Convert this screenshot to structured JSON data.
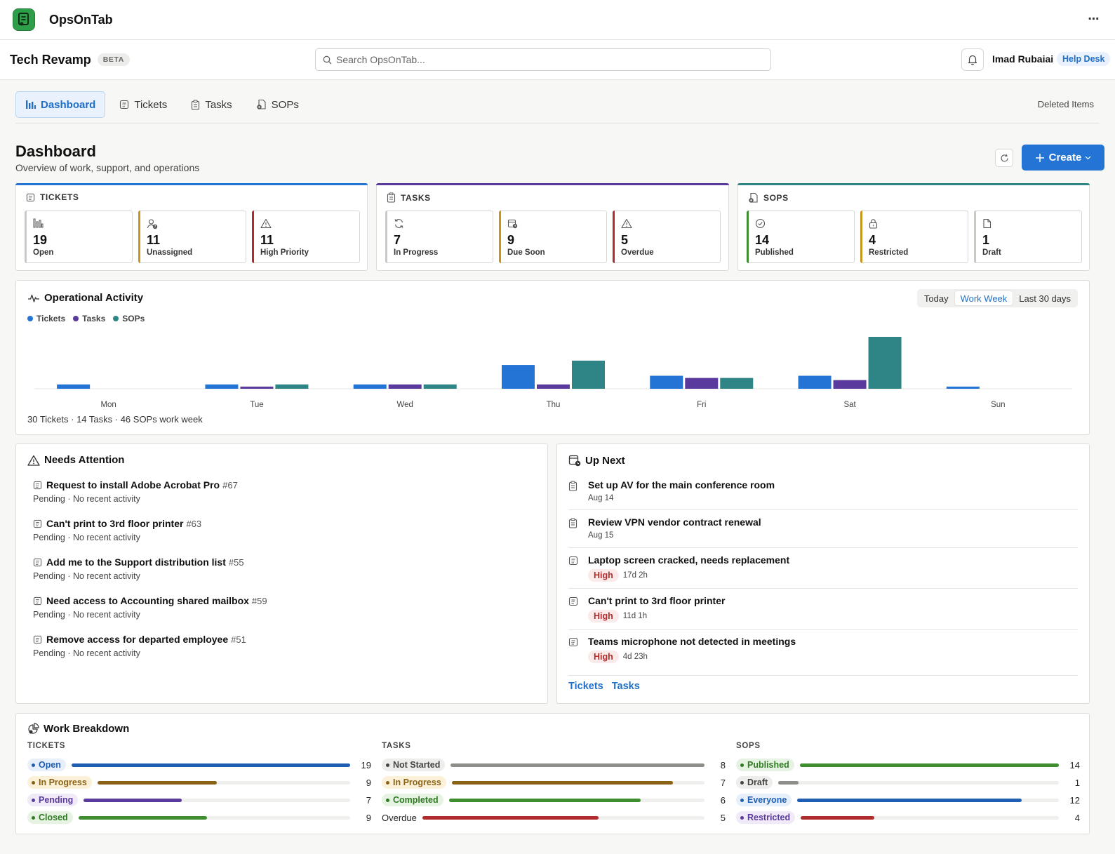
{
  "app": {
    "name": "OpsOnTab",
    "more_label": "⋯"
  },
  "project": {
    "title": "Tech Revamp",
    "badge": "BETA"
  },
  "search": {
    "placeholder": "Search OpsOnTab..."
  },
  "user": {
    "name": "Imad Rubaiai",
    "role_badge": "Help Desk"
  },
  "tabs": [
    {
      "label": "Dashboard",
      "icon": "bar-chart-icon",
      "active": true
    },
    {
      "label": "Tickets",
      "icon": "ticket-icon"
    },
    {
      "label": "Tasks",
      "icon": "clipboard-icon"
    },
    {
      "label": "SOPs",
      "icon": "sop-doc-icon"
    }
  ],
  "deleted_items_label": "Deleted Items",
  "page": {
    "title": "Dashboard",
    "subtitle": "Overview of work, support, and operations",
    "create_label": "Create"
  },
  "stats": {
    "tickets": {
      "heading": "TICKETS",
      "color": "#2374d4",
      "cards": [
        {
          "value": "19",
          "label": "Open",
          "icon": "bars-icon",
          "accent": "#c9c9c6"
        },
        {
          "value": "11",
          "label": "Unassigned",
          "icon": "user-question-icon",
          "accent": "#c8951f"
        },
        {
          "value": "11",
          "label": "High Priority",
          "icon": "warning-icon",
          "accent": "#b02b2b"
        }
      ]
    },
    "tasks": {
      "heading": "TASKS",
      "color": "#5a3a9c",
      "cards": [
        {
          "value": "7",
          "label": "In Progress",
          "icon": "sync-icon",
          "accent": "#c9c9c6"
        },
        {
          "value": "9",
          "label": "Due Soon",
          "icon": "calendar-clock-icon",
          "accent": "#c8951f"
        },
        {
          "value": "5",
          "label": "Overdue",
          "icon": "warning-icon",
          "accent": "#b02b2b"
        }
      ]
    },
    "sops": {
      "heading": "SOPS",
      "color": "#2f8585",
      "cards": [
        {
          "value": "14",
          "label": "Published",
          "icon": "check-circle-icon",
          "accent": "#3e8e2f"
        },
        {
          "value": "4",
          "label": "Restricted",
          "icon": "lock-icon",
          "accent": "#c8951f"
        },
        {
          "value": "1",
          "label": "Draft",
          "icon": "document-icon",
          "accent": "#c9c9c6"
        }
      ]
    }
  },
  "activity": {
    "title": "Operational Activity",
    "ranges": [
      "Today",
      "Work Week",
      "Last 30 days"
    ],
    "active_range": "Work Week",
    "summary": "30 Tickets · 14 Tasks · 46 SOPs work week"
  },
  "chart_data": {
    "type": "bar",
    "categories": [
      "Mon",
      "Tue",
      "Wed",
      "Thu",
      "Fri",
      "Sat",
      "Sun"
    ],
    "series": [
      {
        "name": "Tickets",
        "color": "#2374d4",
        "values": [
          2,
          2,
          2,
          11,
          6,
          6,
          1
        ]
      },
      {
        "name": "Tasks",
        "color": "#5a3a9c",
        "values": [
          0,
          1,
          2,
          2,
          5,
          4,
          0
        ]
      },
      {
        "name": "SOPs",
        "color": "#2f8585",
        "values": [
          0,
          2,
          2,
          13,
          5,
          24,
          0
        ]
      }
    ],
    "ylim": [
      0,
      24
    ],
    "legend": "top-left",
    "grid": false
  },
  "needs_attention": {
    "title": "Needs Attention",
    "items": [
      {
        "title": "Request to install Adobe Acrobat Pro",
        "num": "#67",
        "meta": "Pending · No recent activity"
      },
      {
        "title": "Can't print to 3rd floor printer",
        "num": "#63",
        "meta": "Pending · No recent activity"
      },
      {
        "title": "Add me to the Support distribution list",
        "num": "#55",
        "meta": "Pending · No recent activity"
      },
      {
        "title": "Need access to Accounting shared mailbox",
        "num": "#59",
        "meta": "Pending · No recent activity"
      },
      {
        "title": "Remove access for departed employee",
        "num": "#51",
        "meta": "Pending · No recent activity"
      }
    ]
  },
  "up_next": {
    "title": "Up Next",
    "items": [
      {
        "title": "Set up AV for the main conference room",
        "meta": "Aug 14",
        "kind": "task"
      },
      {
        "title": "Review VPN vendor contract renewal",
        "meta": "Aug 15",
        "kind": "task"
      },
      {
        "title": "Laptop screen cracked, needs replacement",
        "priority": "High",
        "meta": "17d 2h",
        "kind": "ticket"
      },
      {
        "title": "Can't print to 3rd floor printer",
        "priority": "High",
        "meta": "11d 1h",
        "kind": "ticket"
      },
      {
        "title": "Teams microphone not detected in meetings",
        "priority": "High",
        "meta": "4d 23h",
        "kind": "ticket"
      }
    ],
    "links": [
      "Tickets",
      "Tasks"
    ]
  },
  "breakdown": {
    "title": "Work Breakdown",
    "columns": [
      {
        "heading": "TICKETS",
        "max": 19,
        "rows": [
          {
            "label": "Open",
            "count": 19,
            "color": "#1f5fb3",
            "pill_bg": "#e6effa",
            "pill_fg": "#1f5fb3"
          },
          {
            "label": "In Progress",
            "count": 9,
            "color": "#8a6416",
            "pill_bg": "#fbf1d8",
            "pill_fg": "#8a6416"
          },
          {
            "label": "Pending",
            "count": 7,
            "color": "#5a3a9c",
            "pill_bg": "#efe9f8",
            "pill_fg": "#5a3a9c"
          },
          {
            "label": "Closed",
            "count": 9,
            "color": "#3e8e2f",
            "pill_bg": "#e6f3e2",
            "pill_fg": "#2f7a22"
          }
        ]
      },
      {
        "heading": "TASKS",
        "max": 8,
        "rows": [
          {
            "label": "Not Started",
            "count": 8,
            "color": "#8d8d8a",
            "pill_bg": "#ededeb",
            "pill_fg": "#444444"
          },
          {
            "label": "In Progress",
            "count": 7,
            "color": "#8a6416",
            "pill_bg": "#fbf1d8",
            "pill_fg": "#8a6416"
          },
          {
            "label": "Completed",
            "count": 6,
            "color": "#3e8e2f",
            "pill_bg": "#e6f3e2",
            "pill_fg": "#2f7a22"
          },
          {
            "label": "Overdue",
            "count": 5,
            "color": "#b02b2b",
            "plain": true
          }
        ]
      },
      {
        "heading": "SOPS",
        "max": 14,
        "rows": [
          {
            "label": "Published",
            "count": 14,
            "color": "#3e8e2f",
            "pill_bg": "#e6f3e2",
            "pill_fg": "#2f7a22"
          },
          {
            "label": "Draft",
            "count": 1,
            "color": "#8d8d8a",
            "pill_bg": "#ededeb",
            "pill_fg": "#444444"
          },
          {
            "label": "Everyone",
            "count": 12,
            "color": "#1f5fb3",
            "pill_bg": "#e6effa",
            "pill_fg": "#1f5fb3"
          },
          {
            "label": "Restricted",
            "count": 4,
            "color": "#b02b2b",
            "pill_bg": "#efe9f8",
            "pill_fg": "#5a3a9c"
          }
        ]
      }
    ]
  }
}
